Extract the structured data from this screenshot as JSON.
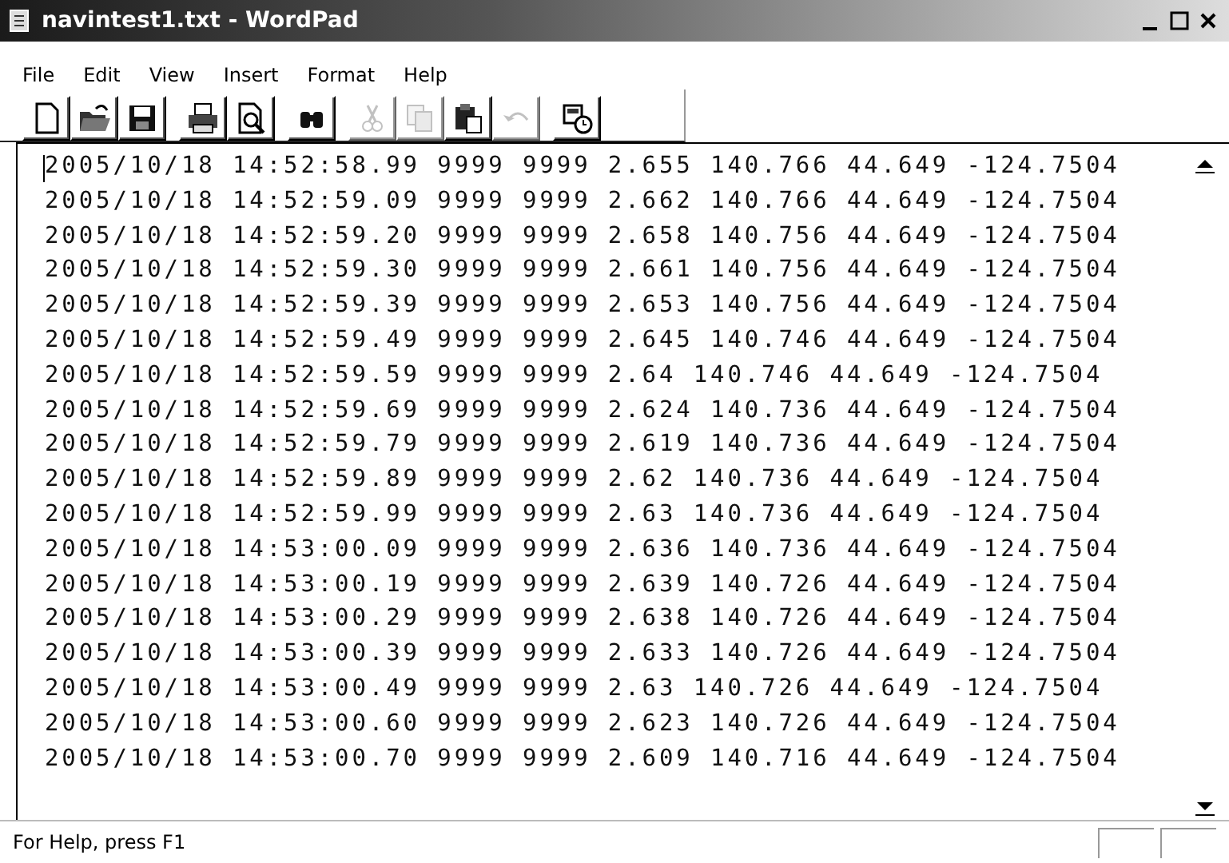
{
  "window": {
    "title": "navintest1.txt - WordPad"
  },
  "menu": [
    "File",
    "Edit",
    "View",
    "Insert",
    "Format",
    "Help"
  ],
  "toolbar": [
    [
      {
        "kind": "new",
        "disabled": false
      },
      {
        "kind": "open",
        "disabled": false
      },
      {
        "kind": "save",
        "disabled": false
      }
    ],
    [
      {
        "kind": "print",
        "disabled": false
      },
      {
        "kind": "preview",
        "disabled": false
      }
    ],
    [
      {
        "kind": "find",
        "disabled": false
      }
    ],
    [
      {
        "kind": "cut",
        "disabled": true
      },
      {
        "kind": "copy",
        "disabled": true
      },
      {
        "kind": "paste",
        "disabled": false
      },
      {
        "kind": "undo",
        "disabled": true
      }
    ],
    [
      {
        "kind": "datetime",
        "disabled": false
      }
    ]
  ],
  "document": {
    "lines": [
      "2005/10/18 14:52:58.99 9999 9999 2.655 140.766 44.649 -124.7504",
      "2005/10/18 14:52:59.09 9999 9999 2.662 140.766 44.649 -124.7504",
      "2005/10/18 14:52:59.20 9999 9999 2.658 140.756 44.649 -124.7504",
      "2005/10/18 14:52:59.30 9999 9999 2.661 140.756 44.649 -124.7504",
      "2005/10/18 14:52:59.39 9999 9999 2.653 140.756 44.649 -124.7504",
      "2005/10/18 14:52:59.49 9999 9999 2.645 140.746 44.649 -124.7504",
      "2005/10/18 14:52:59.59 9999 9999 2.64 140.746 44.649 -124.7504",
      "2005/10/18 14:52:59.69 9999 9999 2.624 140.736 44.649 -124.7504",
      "2005/10/18 14:52:59.79 9999 9999 2.619 140.736 44.649 -124.7504",
      "2005/10/18 14:52:59.89 9999 9999 2.62 140.736 44.649 -124.7504",
      "2005/10/18 14:52:59.99 9999 9999 2.63 140.736 44.649 -124.7504",
      "2005/10/18 14:53:00.09 9999 9999 2.636 140.736 44.649 -124.7504",
      "2005/10/18 14:53:00.19 9999 9999 2.639 140.726 44.649 -124.7504",
      "2005/10/18 14:53:00.29 9999 9999 2.638 140.726 44.649 -124.7504",
      "2005/10/18 14:53:00.39 9999 9999 2.633 140.726 44.649 -124.7504",
      "2005/10/18 14:53:00.49 9999 9999 2.63 140.726 44.649 -124.7504",
      "2005/10/18 14:53:00.60 9999 9999 2.623 140.726 44.649 -124.7504",
      "2005/10/18 14:53:00.70 9999 9999 2.609 140.716 44.649 -124.7504"
    ]
  },
  "status_bar": {
    "text": "For Help, press F1"
  }
}
